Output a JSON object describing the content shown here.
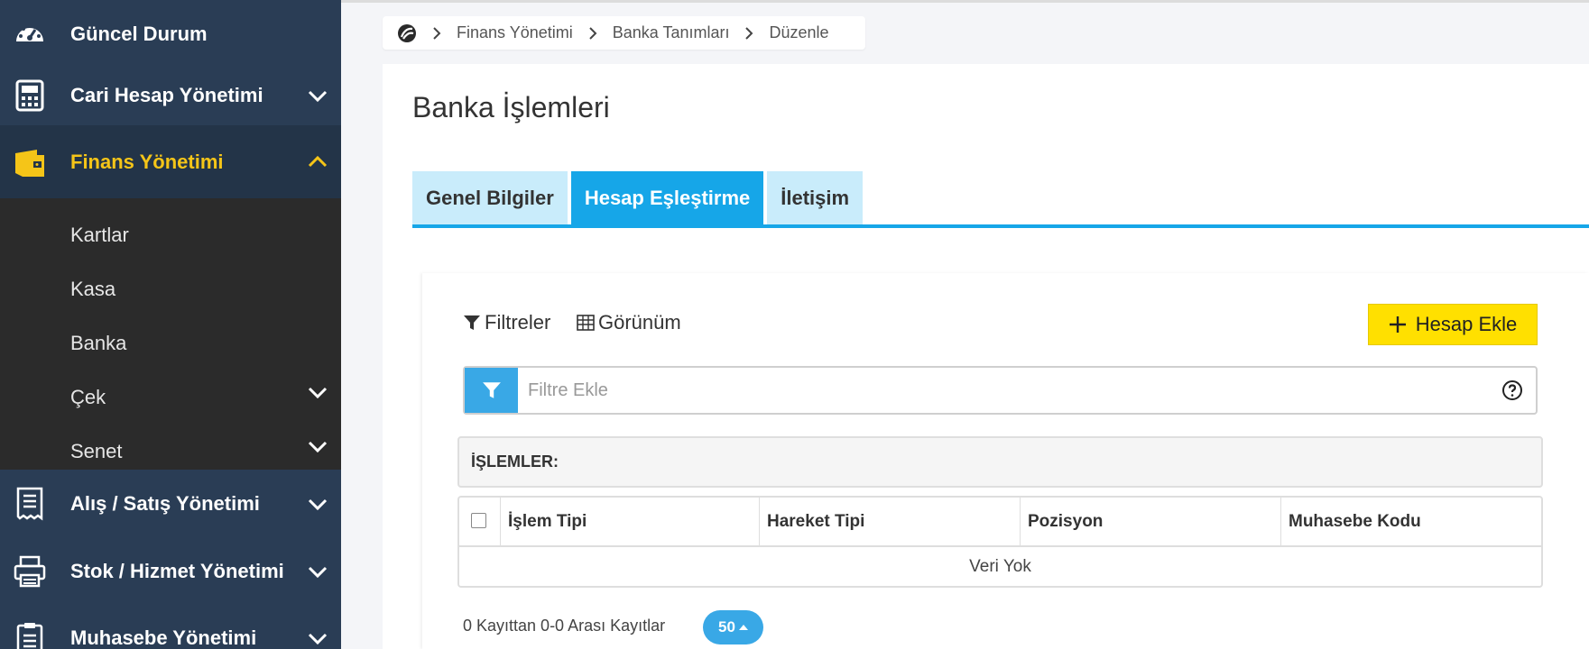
{
  "sidebar": {
    "items": [
      {
        "label": "Güncel Durum",
        "icon": "dashboard-icon"
      },
      {
        "label": "Cari Hesap Yönetimi",
        "icon": "calculator-icon"
      },
      {
        "label": "Finans Yönetimi",
        "icon": "wallet-icon",
        "active": true
      },
      {
        "label": "Alış / Satış Yönetimi",
        "icon": "receipt-icon"
      },
      {
        "label": "Stok / Hizmet Yönetimi",
        "icon": "printer-icon"
      },
      {
        "label": "Muhasebe Yönetimi",
        "icon": "clipboard-icon"
      }
    ],
    "submenu": [
      {
        "label": "Kartlar"
      },
      {
        "label": "Kasa"
      },
      {
        "label": "Banka"
      },
      {
        "label": "Çek"
      },
      {
        "label": "Senet"
      }
    ]
  },
  "breadcrumb": {
    "icon": "brand-logo-icon",
    "items": [
      "Finans Yönetimi",
      "Banka Tanımları",
      "Düzenle"
    ]
  },
  "page": {
    "title": "Banka İşlemleri"
  },
  "tabs": [
    {
      "label": "Genel Bilgiler",
      "active": false
    },
    {
      "label": "Hesap Eşleştirme",
      "active": true
    },
    {
      "label": "İletişim",
      "active": false
    }
  ],
  "toolbar": {
    "filters_label": "Filtreler",
    "view_label": "Görünüm",
    "add_account_label": "Hesap Ekle"
  },
  "filter": {
    "placeholder": "Filtre Ekle"
  },
  "operations": {
    "header": "İŞLEMLER:"
  },
  "table": {
    "columns": [
      "İşlem Tipi",
      "Hareket Tipi",
      "Pozisyon",
      "Muhasebe Kodu"
    ],
    "empty_text": "Veri Yok"
  },
  "pagination": {
    "info": "0 Kayıttan 0-0 Arası Kayıtlar",
    "page_size": "50"
  },
  "colors": {
    "sidebar_bg": "#2a3d55",
    "active_text": "#f5c518",
    "submenu_bg": "#2b2b2b",
    "accent_blue": "#16a6e8",
    "tab_inactive": "#c9ecfb",
    "add_button": "#ffe000"
  }
}
